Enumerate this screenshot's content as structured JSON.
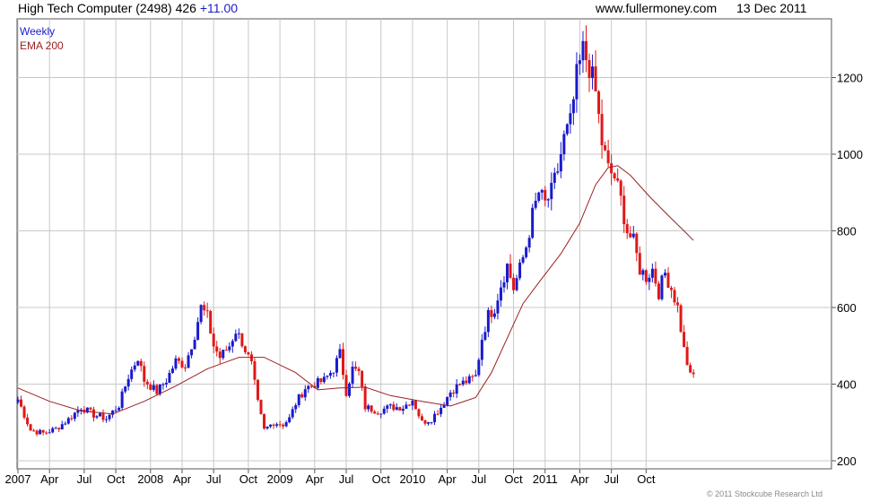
{
  "header": {
    "symbol_text": "High Tech Computer (2498) 426",
    "change": "+11.00",
    "source": "www.fullermoney.com",
    "date": "13 Dec 2011"
  },
  "legend": {
    "weekly": "Weekly",
    "ema": "EMA 200"
  },
  "copyright": "© 2011 Stockcube Research Ltd",
  "colors": {
    "up": "#1a1acc",
    "down": "#e01818",
    "ema": "#9b2020",
    "grid": "#c8c8c8",
    "frame": "#555555"
  },
  "chart_data": {
    "type": "candlestick",
    "title": "High Tech Computer (2498)",
    "frequency": "Weekly",
    "y_scale": "linear",
    "ylim": [
      200,
      1310
    ],
    "y_ticks": [
      200,
      400,
      600,
      800,
      1000,
      1200
    ],
    "x_range_weeks": [
      0,
      258
    ],
    "x_ticks": [
      {
        "label": "2007",
        "week": 0
      },
      {
        "label": "Apr",
        "week": 10
      },
      {
        "label": "Jul",
        "week": 21
      },
      {
        "label": "Oct",
        "week": 31
      },
      {
        "label": "2008",
        "week": 42
      },
      {
        "label": "Apr",
        "week": 52
      },
      {
        "label": "Jul",
        "week": 62
      },
      {
        "label": "Oct",
        "week": 73
      },
      {
        "label": "2009",
        "week": 83
      },
      {
        "label": "Apr",
        "week": 94
      },
      {
        "label": "Jul",
        "week": 104
      },
      {
        "label": "Oct",
        "week": 115
      },
      {
        "label": "2010",
        "week": 125
      },
      {
        "label": "Apr",
        "week": 136
      },
      {
        "label": "Jul",
        "week": 146
      },
      {
        "label": "Oct",
        "week": 157
      },
      {
        "label": "2011",
        "week": 167
      },
      {
        "label": "Apr",
        "week": 178
      },
      {
        "label": "Jul",
        "week": 188
      },
      {
        "label": "Oct",
        "week": 199
      }
    ],
    "series": [
      {
        "name": "Weekly",
        "style": "candlestick",
        "closes": [
          {
            "week": 0,
            "close": 360
          },
          {
            "week": 4,
            "close": 280
          },
          {
            "week": 8,
            "close": 272
          },
          {
            "week": 12,
            "close": 283
          },
          {
            "week": 16,
            "close": 308
          },
          {
            "week": 20,
            "close": 340
          },
          {
            "week": 24,
            "close": 320
          },
          {
            "week": 28,
            "close": 310
          },
          {
            "week": 32,
            "close": 345
          },
          {
            "week": 35,
            "close": 420
          },
          {
            "week": 38,
            "close": 470
          },
          {
            "week": 40,
            "close": 410
          },
          {
            "week": 44,
            "close": 380
          },
          {
            "week": 47,
            "close": 410
          },
          {
            "week": 50,
            "close": 460
          },
          {
            "week": 53,
            "close": 450
          },
          {
            "week": 56,
            "close": 530
          },
          {
            "week": 58,
            "close": 600
          },
          {
            "week": 60,
            "close": 575
          },
          {
            "week": 62,
            "close": 500
          },
          {
            "week": 64,
            "close": 470
          },
          {
            "week": 67,
            "close": 500
          },
          {
            "week": 69,
            "close": 540
          },
          {
            "week": 71,
            "close": 510
          },
          {
            "week": 74,
            "close": 450
          },
          {
            "week": 76,
            "close": 350
          },
          {
            "week": 78,
            "close": 280
          },
          {
            "week": 81,
            "close": 300
          },
          {
            "week": 84,
            "close": 295
          },
          {
            "week": 86,
            "close": 310
          },
          {
            "week": 88,
            "close": 350
          },
          {
            "week": 91,
            "close": 390
          },
          {
            "week": 94,
            "close": 400
          },
          {
            "week": 97,
            "close": 410
          },
          {
            "week": 100,
            "close": 440
          },
          {
            "week": 102,
            "close": 480
          },
          {
            "week": 104,
            "close": 380
          },
          {
            "week": 106,
            "close": 440
          },
          {
            "week": 108,
            "close": 430
          },
          {
            "week": 110,
            "close": 340
          },
          {
            "week": 114,
            "close": 330
          },
          {
            "week": 118,
            "close": 340
          },
          {
            "week": 122,
            "close": 340
          },
          {
            "week": 125,
            "close": 360
          },
          {
            "week": 128,
            "close": 300
          },
          {
            "week": 131,
            "close": 310
          },
          {
            "week": 134,
            "close": 340
          },
          {
            "week": 137,
            "close": 380
          },
          {
            "week": 140,
            "close": 400
          },
          {
            "week": 143,
            "close": 410
          },
          {
            "week": 145,
            "close": 420
          },
          {
            "week": 147,
            "close": 520
          },
          {
            "week": 149,
            "close": 580
          },
          {
            "week": 151,
            "close": 600
          },
          {
            "week": 153,
            "close": 660
          },
          {
            "week": 155,
            "close": 710
          },
          {
            "week": 157,
            "close": 650
          },
          {
            "week": 159,
            "close": 700
          },
          {
            "week": 161,
            "close": 760
          },
          {
            "week": 163,
            "close": 840
          },
          {
            "week": 165,
            "close": 900
          },
          {
            "week": 167,
            "close": 870
          },
          {
            "week": 169,
            "close": 900
          },
          {
            "week": 171,
            "close": 960
          },
          {
            "week": 173,
            "close": 1040
          },
          {
            "week": 175,
            "close": 1080
          },
          {
            "week": 177,
            "close": 1200
          },
          {
            "week": 179,
            "close": 1270
          },
          {
            "week": 181,
            "close": 1230
          },
          {
            "week": 183,
            "close": 1160
          },
          {
            "week": 185,
            "close": 1030
          },
          {
            "week": 187,
            "close": 960
          },
          {
            "week": 189,
            "close": 940
          },
          {
            "week": 191,
            "close": 880
          },
          {
            "week": 193,
            "close": 800
          },
          {
            "week": 195,
            "close": 770
          },
          {
            "week": 197,
            "close": 700
          },
          {
            "week": 199,
            "close": 680
          },
          {
            "week": 201,
            "close": 700
          },
          {
            "week": 203,
            "close": 640
          },
          {
            "week": 205,
            "close": 690
          },
          {
            "week": 207,
            "close": 650
          },
          {
            "week": 209,
            "close": 600
          },
          {
            "week": 211,
            "close": 490
          },
          {
            "week": 213,
            "close": 420
          },
          {
            "week": 214,
            "close": 426
          }
        ]
      },
      {
        "name": "EMA 200",
        "style": "line",
        "points": [
          {
            "week": 0,
            "value": 390
          },
          {
            "week": 10,
            "value": 355
          },
          {
            "week": 20,
            "value": 330
          },
          {
            "week": 30,
            "value": 322
          },
          {
            "week": 40,
            "value": 355
          },
          {
            "week": 50,
            "value": 395
          },
          {
            "week": 60,
            "value": 440
          },
          {
            "week": 70,
            "value": 470
          },
          {
            "week": 78,
            "value": 470
          },
          {
            "week": 88,
            "value": 430
          },
          {
            "week": 95,
            "value": 385
          },
          {
            "week": 102,
            "value": 390
          },
          {
            "week": 110,
            "value": 392
          },
          {
            "week": 118,
            "value": 370
          },
          {
            "week": 128,
            "value": 355
          },
          {
            "week": 137,
            "value": 343
          },
          {
            "week": 145,
            "value": 365
          },
          {
            "week": 150,
            "value": 430
          },
          {
            "week": 155,
            "value": 520
          },
          {
            "week": 160,
            "value": 610
          },
          {
            "week": 165,
            "value": 665
          },
          {
            "week": 172,
            "value": 740
          },
          {
            "week": 178,
            "value": 820
          },
          {
            "week": 183,
            "value": 920
          },
          {
            "week": 187,
            "value": 965
          },
          {
            "week": 190,
            "value": 970
          },
          {
            "week": 194,
            "value": 945
          },
          {
            "week": 200,
            "value": 890
          },
          {
            "week": 206,
            "value": 840
          },
          {
            "week": 211,
            "value": 800
          },
          {
            "week": 214,
            "value": 775
          }
        ]
      }
    ],
    "last_close": 426,
    "grid": true,
    "y_axis_side": "right"
  }
}
